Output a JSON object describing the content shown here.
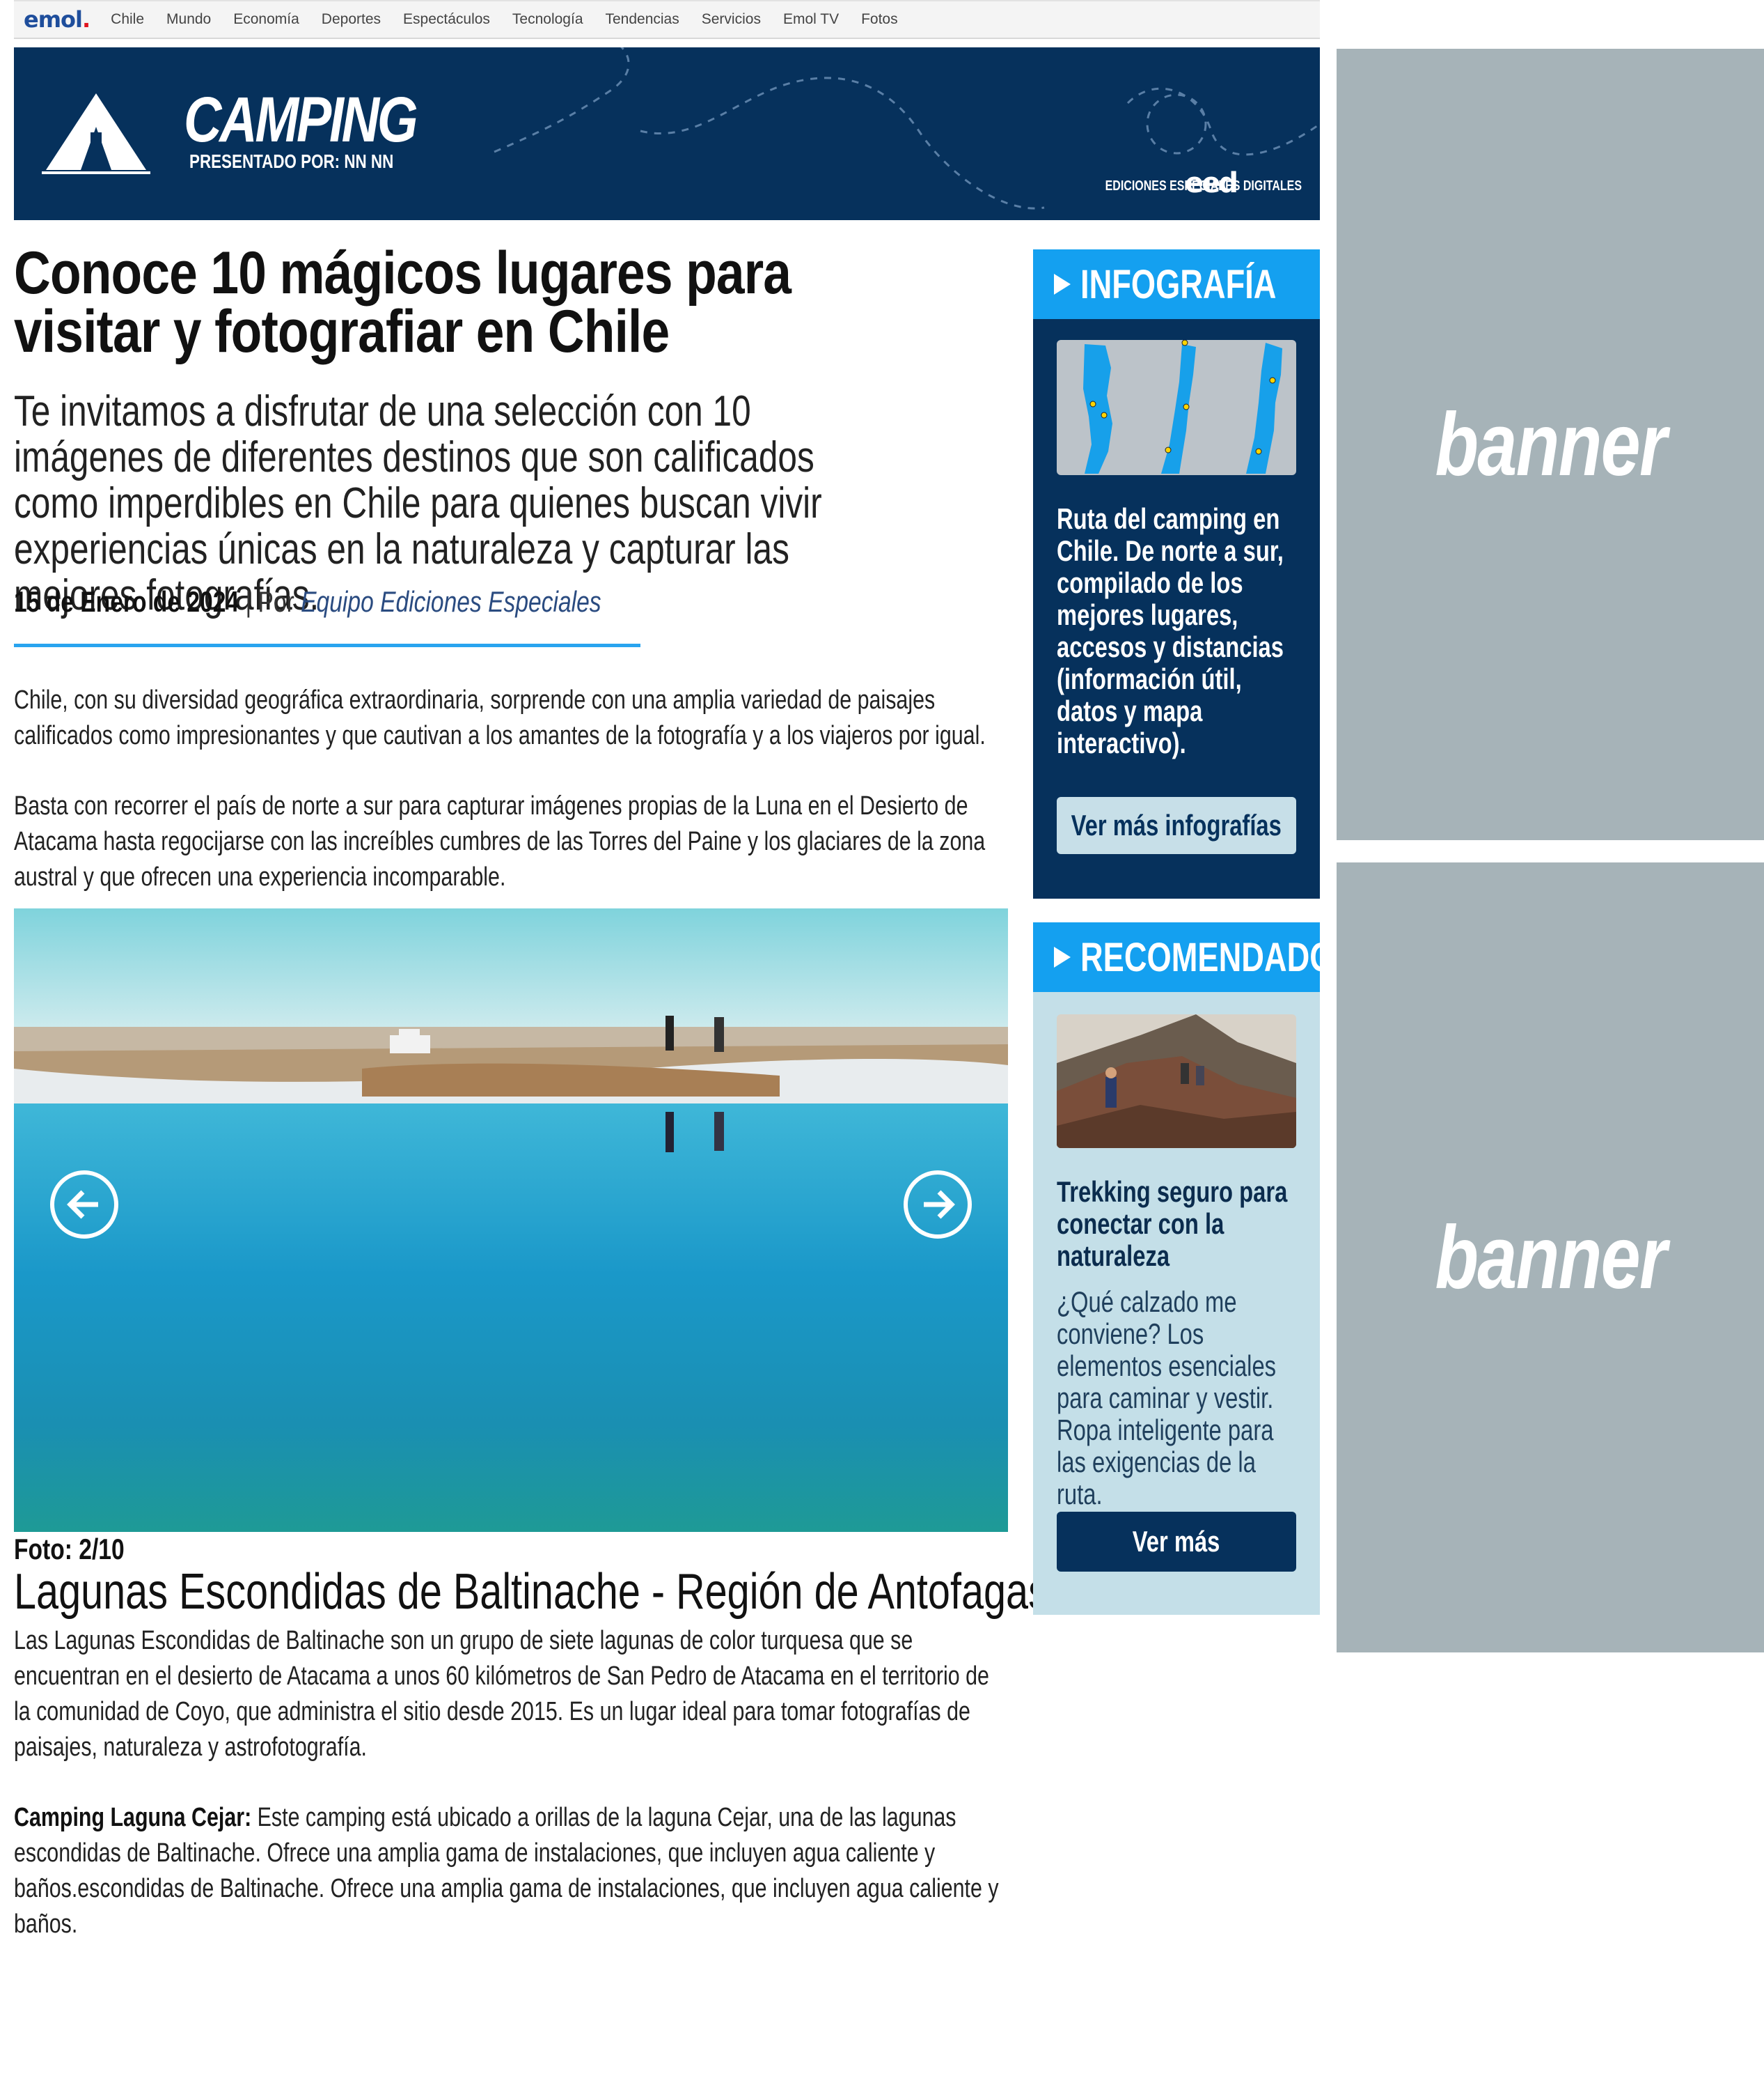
{
  "nav": {
    "logo_text": "emol",
    "logo_dot": ".",
    "items": [
      "Chile",
      "Mundo",
      "Economía",
      "Deportes",
      "Espectáculos",
      "Tecnología",
      "Tendencias",
      "Servicios",
      "Emol TV",
      "Fotos"
    ]
  },
  "header": {
    "title": "CAMPING",
    "presented_by": "PRESENTADO POR: NN NN",
    "eed_logo": "eed",
    "eed_text": "EDICIONES ESPECIALES DIGITALES"
  },
  "article": {
    "headline": "Conoce 10 mágicos lugares para visitar y fotografiar en Chile",
    "subtitle": "Te invitamos a disfrutar de una selección con 10 imágenes de diferentes destinos que son calificados como imperdibles en Chile para quienes buscan vivir experiencias únicas en la naturaleza y capturar las mejores fotografías.",
    "date": "15 de Enero de 2024",
    "separator": " | Por ",
    "author": "Equipo Ediciones Especiales",
    "paragraph1": "Chile, con su diversidad geográfica extraordinaria, sorprende con una amplia variedad de paisajes calificados como impresionantes y que cautivan a los amantes de la fotografía y a los viajeros por igual.",
    "paragraph2": "Basta con recorrer el país de norte a sur para capturar imágenes propias de la Luna en el Desierto de Atacama hasta regocijarse con las increíbles cumbres de las Torres del Paine y los glaciares de la zona austral y que ofrecen una experiencia incomparable."
  },
  "gallery": {
    "counter": "Foto: 2/10",
    "title": "Lagunas Escondidas de Baltinache - Región de Antofagasta",
    "description": "Las Lagunas Escondidas de Baltinache son un grupo de siete lagunas de color turquesa que se encuentran en el desierto de Atacama a unos 60 kilómetros de San Pedro de Atacama en el territorio de la comunidad de Coyo, que administra el sitio desde 2015. Es un lugar ideal para tomar fotografías de paisajes, naturaleza y astrofotografía.",
    "camping_label": "Camping Laguna Cejar:",
    "camping_text": " Este camping está ubicado a orillas de la laguna Cejar, una de las lagunas escondidas de Baltinache. Ofrece una amplia gama de instalaciones, que incluyen agua caliente y baños.escondidas de Baltinache. Ofrece una amplia gama de instalaciones, que incluyen agua caliente y baños."
  },
  "infografia": {
    "heading": "INFOGRAFÍA",
    "text": "Ruta del camping en Chile. De norte a sur, compilado de los mejores lugares, accesos y distancias (información útil, datos y mapa interactivo).",
    "button": "Ver más infografías"
  },
  "recomendado": {
    "heading": "RECOMENDADO",
    "title": "Trekking seguro para conectar con la naturaleza",
    "text": "¿Qué calzado me conviene? Los elementos esenciales para caminar y vestir. Ropa inteligente para las exigencias de la ruta.",
    "button": "Ver más"
  },
  "banners": [
    "banner",
    "banner"
  ],
  "colors": {
    "navy": "#06315c",
    "accent_blue": "#14a0f0",
    "light_blue": "#c4dfe8",
    "banner_gray": "#a6b3b8"
  },
  "icons": [
    "tent-icon",
    "arrow-left-icon",
    "arrow-right-icon",
    "triangle-play-icon"
  ]
}
